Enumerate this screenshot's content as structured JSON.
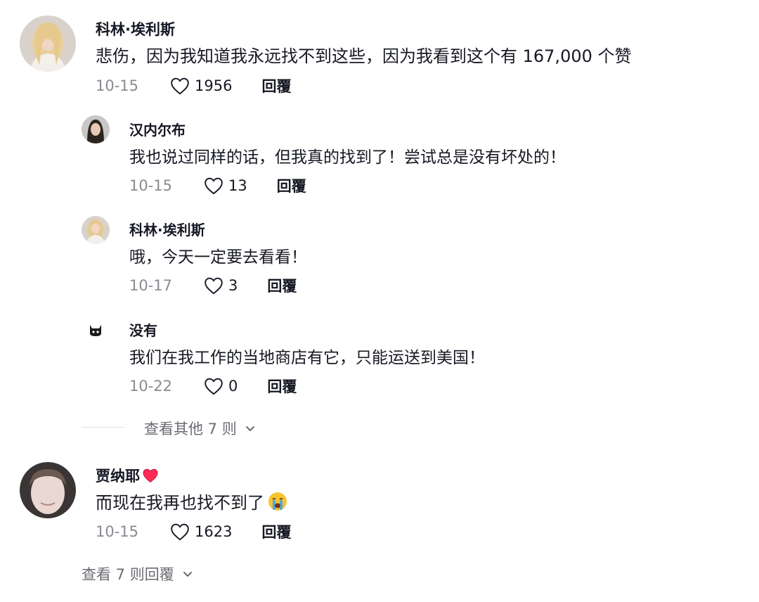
{
  "comments": [
    {
      "author": "科林·埃利斯",
      "text": "悲伤，因为我知道我永远找不到这些，因为我看到这个有 167,000 个赞",
      "date": "10-15",
      "likes": "1956",
      "reply_label": "回覆",
      "replies": [
        {
          "author": "汉内尔布",
          "text": "我也说过同样的话，但我真的找到了！尝试总是没有坏处的！",
          "date": "10-15",
          "likes": "13",
          "reply_label": "回覆"
        },
        {
          "author": "科林·埃利斯",
          "text": "哦，今天一定要去看看！",
          "date": "10-17",
          "likes": "3",
          "reply_label": "回覆"
        },
        {
          "author": "没有",
          "text": "我们在我工作的当地商店有它，只能运送到美国！",
          "date": "10-22",
          "likes": "0",
          "reply_label": "回覆"
        }
      ],
      "view_more": "查看其他 7 则"
    },
    {
      "author": "贾纳耶",
      "author_emoji": "red-heart",
      "text": "而现在我再也找不到了",
      "text_emoji": "crying-face",
      "date": "10-15",
      "likes": "1623",
      "reply_label": "回覆",
      "view_replies": "查看 7 则回覆"
    }
  ],
  "colors": {
    "text": "#161823",
    "muted": "#8a8b91",
    "heart": "#fe2c55"
  }
}
